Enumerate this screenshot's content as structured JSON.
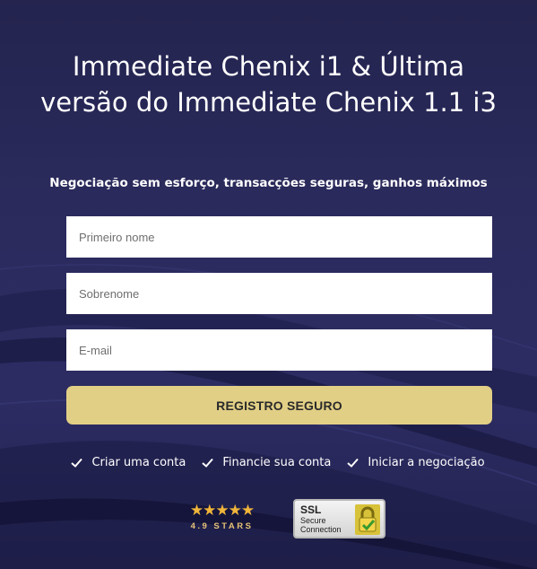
{
  "hero": {
    "title": "Immediate Chenix i1 & Última versão do Immediate Chenix 1.1 i3",
    "subtitle": "Negociação sem esforço, transacções seguras, ganhos máximos"
  },
  "form": {
    "first_name_placeholder": "Primeiro nome",
    "last_name_placeholder": "Sobrenome",
    "email_placeholder": "E-mail",
    "submit_label": "REGISTRO SEGURO"
  },
  "steps": [
    {
      "label": "Criar uma conta",
      "icon": "check-icon"
    },
    {
      "label": "Financie sua conta",
      "icon": "check-icon"
    },
    {
      "label": "Iniciar a negociação",
      "icon": "check-icon"
    }
  ],
  "rating": {
    "stars": 5,
    "text": "4.9 STARS"
  },
  "ssl_badge": {
    "title": "SSL",
    "line1": "Secure",
    "line2": "Connection",
    "icon": "padlock-check-icon"
  },
  "colors": {
    "background": "#2a2a5c",
    "button": "#e2cf86",
    "stars": "#f0b53a",
    "text": "#ffffff"
  }
}
